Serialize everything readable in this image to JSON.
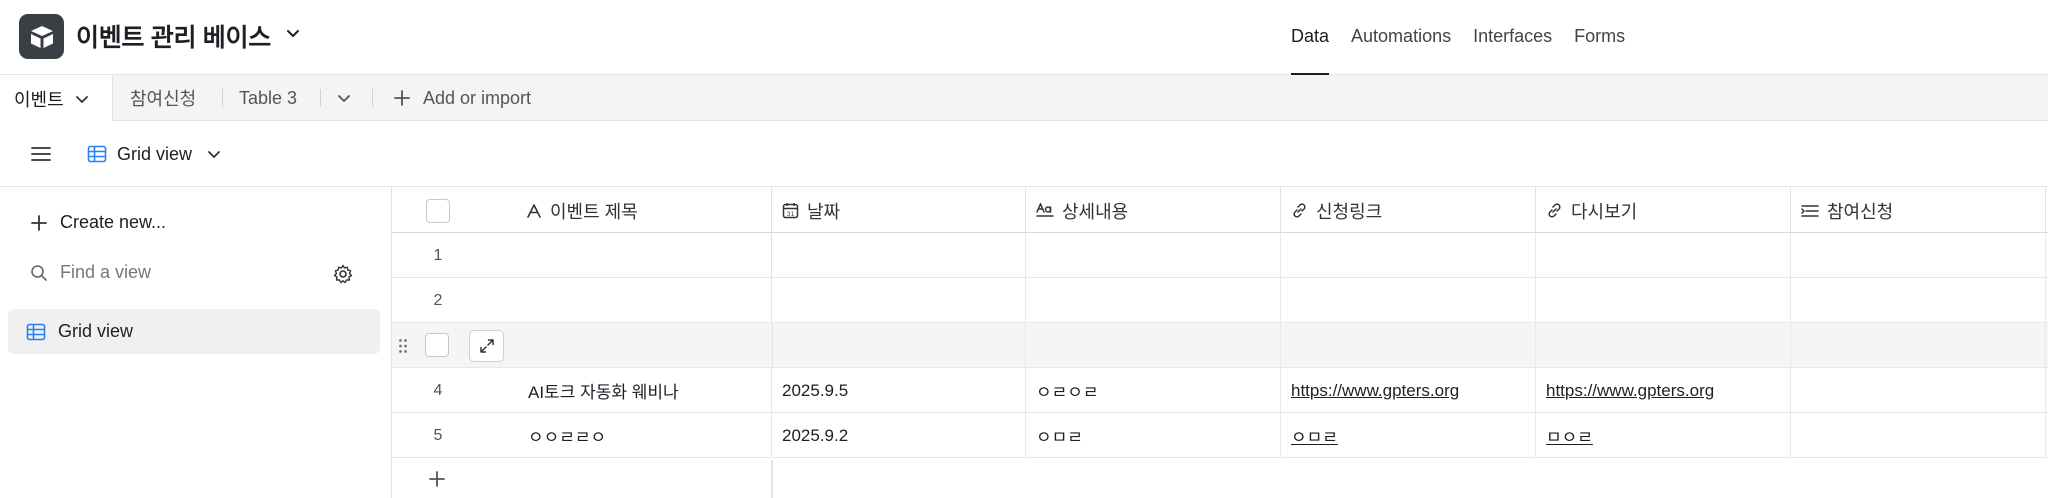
{
  "app": {
    "base_title": "이벤트 관리 베이스",
    "colors": {
      "logo_bg": "#3a3e45",
      "accent": "#1d1f25",
      "view_icon": "#2d7ff9"
    }
  },
  "top_nav": {
    "items": [
      {
        "label": "Data",
        "active": true
      },
      {
        "label": "Automations",
        "active": false
      },
      {
        "label": "Interfaces",
        "active": false
      },
      {
        "label": "Forms",
        "active": false
      }
    ]
  },
  "tables_bar": {
    "tabs": [
      {
        "label": "이벤트",
        "active": true
      },
      {
        "label": "참여신청",
        "active": false
      },
      {
        "label": "Table 3",
        "active": false
      }
    ],
    "add_import_label": "Add or import"
  },
  "view_bar": {
    "current_view": "Grid view"
  },
  "sidebar": {
    "create_new_label": "Create new...",
    "find_placeholder": "Find a view",
    "views": [
      {
        "label": "Grid view",
        "selected": true
      }
    ]
  },
  "grid": {
    "columns": [
      {
        "label": "이벤트 제목",
        "icon": "text-a-icon"
      },
      {
        "label": "날짜",
        "icon": "calendar-icon"
      },
      {
        "label": "상세내용",
        "icon": "long-text-icon"
      },
      {
        "label": "신청링크",
        "icon": "link-icon"
      },
      {
        "label": "다시보기",
        "icon": "link-icon"
      },
      {
        "label": "참여신청",
        "icon": "linked-record-icon"
      }
    ],
    "rows": [
      {
        "num": "1",
        "title": "",
        "date": "",
        "detail": "",
        "apply_link": "",
        "replay": "",
        "participation": ""
      },
      {
        "num": "2",
        "title": "",
        "date": "",
        "detail": "",
        "apply_link": "",
        "replay": "",
        "participation": ""
      },
      {
        "num": "",
        "title": "",
        "date": "",
        "detail": "",
        "apply_link": "",
        "replay": "",
        "participation": ""
      },
      {
        "num": "4",
        "title": "AI토크 자동화 웨비나",
        "date": "2025.9.5",
        "detail": "ㅇㄹㅇㄹ",
        "apply_link": "https://www.gpters.org",
        "replay": "https://www.gpters.org",
        "participation": ""
      },
      {
        "num": "5",
        "title": "ㅇㅇㄹㄹㅇ",
        "date": "2025.9.2",
        "detail": "ㅇㅁㄹ",
        "apply_link": "ㅇㅁㄹ",
        "replay": "ㅁㅇㄹ",
        "participation": ""
      }
    ]
  }
}
